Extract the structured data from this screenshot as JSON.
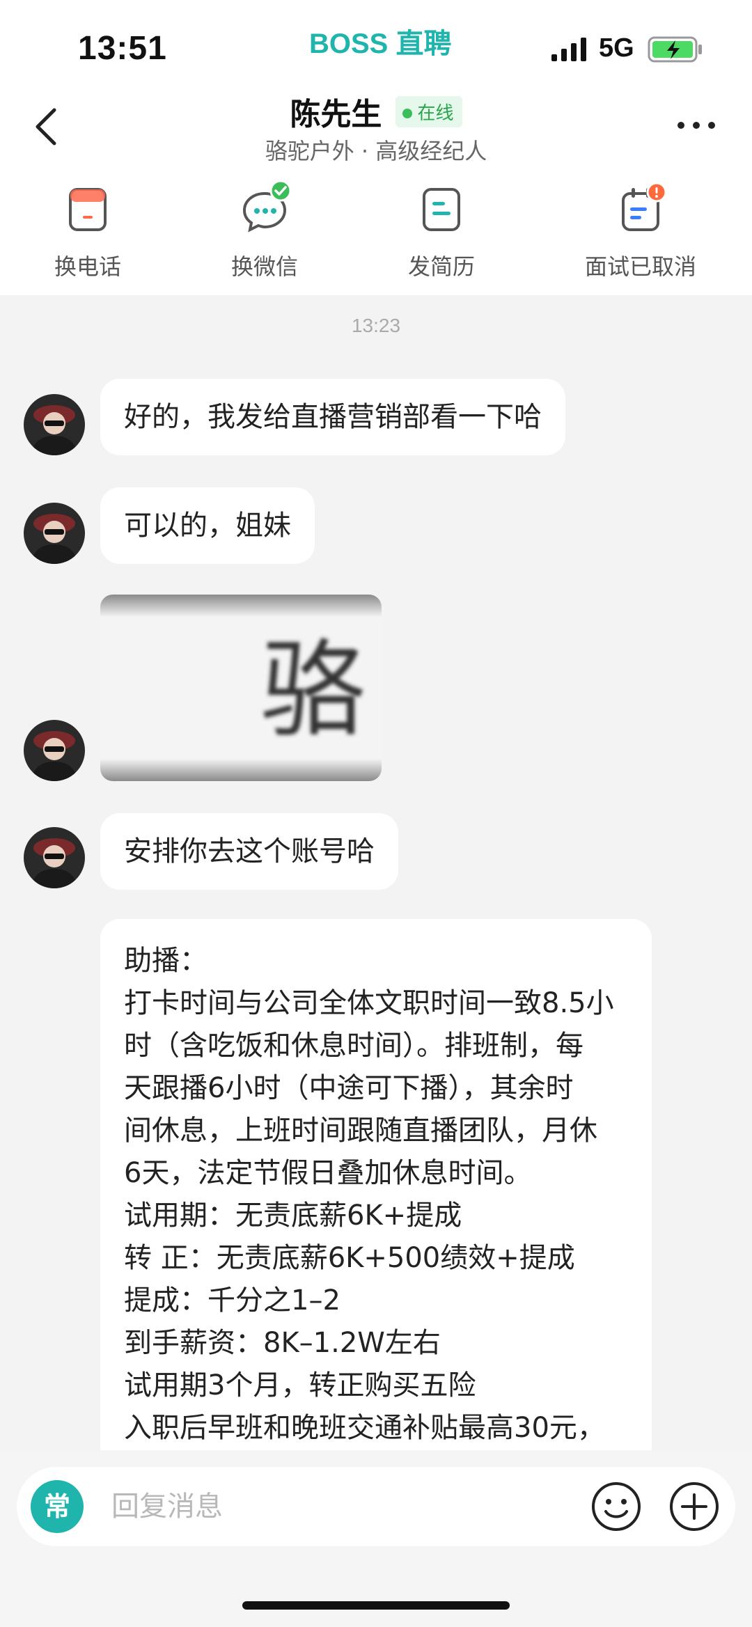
{
  "status_bar": {
    "time": "13:51",
    "app_brand": "BOSS 直聘",
    "network": "5G"
  },
  "header": {
    "contact_name": "陈先生",
    "online_label": "在线",
    "subtitle": "骆驼户外 · 高级经纪人"
  },
  "actions": [
    {
      "label": "换电话",
      "icon": "phone-card-icon"
    },
    {
      "label": "换微信",
      "icon": "wechat-icon"
    },
    {
      "label": "发简历",
      "icon": "resume-icon"
    },
    {
      "label": "面试已取消",
      "icon": "calendar-alert-icon"
    }
  ],
  "chat": {
    "timestamp": "13:23",
    "messages": [
      {
        "type": "text",
        "text": "好的，我发给直播营销部看一下哈"
      },
      {
        "type": "text",
        "text": "可以的，姐妹"
      },
      {
        "type": "image",
        "text": "骆"
      },
      {
        "type": "text",
        "text": "安排你去这个账号哈"
      },
      {
        "type": "text",
        "lines": [
          "助播：",
          "打卡时间与公司全体文职时间一致8.5小",
          "时（含吃饭和休息时间）。排班制，每",
          "天跟播6小时（中途可下播），其余时",
          "间休息，上班时间跟随直播团队，月休",
          "6天，法定节假日叠加休息时间。",
          "试用期：无责底薪6K+提成",
          "转 正：无责底薪6K+500绩效+提成",
          "提成：千分之1–2",
          "到手薪资：8K–1.2W左右",
          "试用期3个月，转正购买五险",
          "入职后早班和晚班交通补贴最高30元，"
        ]
      }
    ]
  },
  "input_bar": {
    "quick_label": "常",
    "placeholder": "回复消息"
  },
  "colors": {
    "brand": "#1fb5ad",
    "online": "#3bbd5a",
    "badge_alert": "#ff6a3d"
  }
}
